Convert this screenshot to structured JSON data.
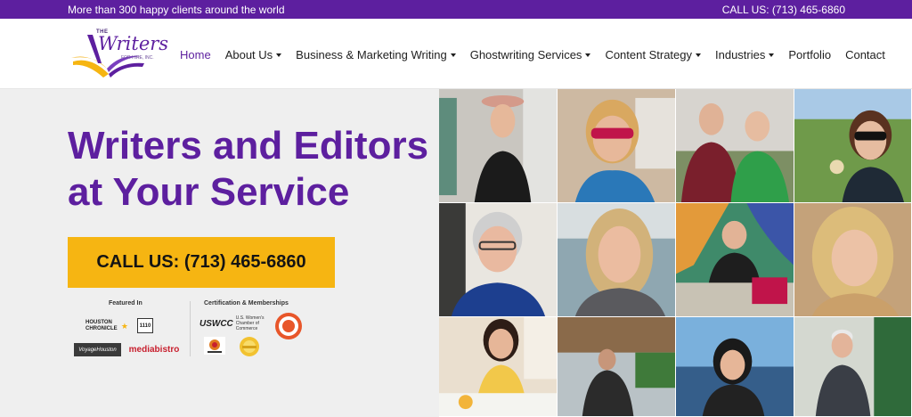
{
  "topbar": {
    "left_text": "More than 300 happy clients around the world",
    "right_text": "CALL US: (713) 465-6860"
  },
  "logo": {
    "the": "THE",
    "main": "Writers",
    "sub": "FOR HIRE, INC."
  },
  "nav": {
    "items": [
      {
        "label": "Home",
        "active": true,
        "dropdown": false
      },
      {
        "label": "About Us",
        "dropdown": true
      },
      {
        "label": "Business & Marketing Writing",
        "dropdown": true
      },
      {
        "label": "Ghostwriting Services",
        "dropdown": true
      },
      {
        "label": "Content Strategy",
        "dropdown": true
      },
      {
        "label": "Industries",
        "dropdown": true
      },
      {
        "label": "Portfolio",
        "dropdown": false
      },
      {
        "label": "Contact",
        "dropdown": false
      }
    ]
  },
  "hero": {
    "title_line1": "Writers and Editors",
    "title_line2": "at Your Service",
    "cta_label": "CALL US: (713) 465-6860"
  },
  "featured": {
    "label": "Featured In",
    "logos": [
      "HOUSTON CHRONICLE",
      "1110",
      "VoyageHouston",
      "mediabistro"
    ]
  },
  "certifications": {
    "label": "Certification & Memberships",
    "uswcc_mark": "USWCC",
    "uswcc_text": "U.S. Women's Chamber of Commerce"
  },
  "colors": {
    "brand_purple": "#5d1f9f",
    "cta_yellow": "#f6b512",
    "hero_bg": "#efefef"
  }
}
